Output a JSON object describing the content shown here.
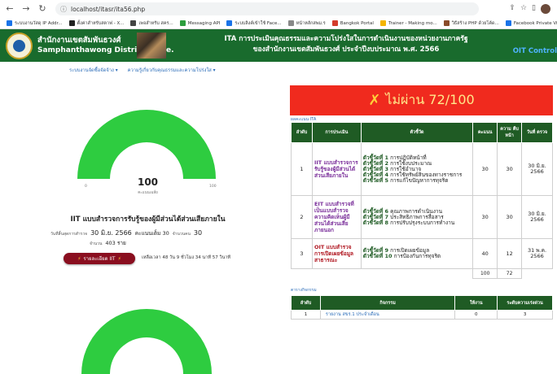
{
  "browser": {
    "url": "localhost/itasr/ita56.php",
    "bookmarks": [
      {
        "label": "ระบบงานวัสดุ IP Addr...",
        "color": "#1a73e8"
      },
      {
        "label": "ตั้งค่าสำหรับสตาฟ - X...",
        "color": "#222222"
      },
      {
        "label": "เพจสำหรับ สคร...",
        "color": "#444444"
      },
      {
        "label": "Messaging API",
        "color": "#2e9e3e"
      },
      {
        "label": "ระบบลิงค์เข้าใช้ Face...",
        "color": "#1a73e8"
      },
      {
        "label": "หน้าหลักสพม.ร",
        "color": "#888888"
      },
      {
        "label": "Bangkok Portal",
        "color": "#d33b2c"
      },
      {
        "label": "Trainer - Making mo...",
        "color": "#f4b400"
      },
      {
        "label": "วิธีสร้าง PHP ด้วยโค้ด...",
        "color": "#8a4b2a"
      },
      {
        "label": "Facebook Private Vi...",
        "color": "#1a73e8"
      }
    ]
  },
  "header": {
    "office_th": "สำนักงานเขตสัมพันธวงศ์",
    "office_en": "Samphanthawong District Office.",
    "ita_line1": "ITA การประเมินคุณธรรมและความโปร่งใสในการดำเนินงานของหน่วยงานภาครัฐ",
    "ita_line2": "ของสำนักงานเขตสัมพันธวงศ์ ประจำปีงบประมาณ พ.ศ. 2566",
    "oit_control": "OIT Control"
  },
  "subnav": {
    "item1": "ระบบงานจัดซื้อจัดจ้าง ▾",
    "item2": "ความรู้เกี่ยวกับคุณธรรมและความโปร่งใส ▾"
  },
  "gauge": {
    "value": "100",
    "min_label": "0",
    "max_label": "100",
    "caption": "คะแนนเฉลี่ย",
    "value_fraction": 1.0,
    "fill_color": "#2ecc40",
    "track_color": "#e6e6e6"
  },
  "indicator": {
    "title": "IIT แบบสำรวจการรับรู้ของผู้มีส่วนได้ส่วนเสียภายใน",
    "end_label": "วันที่สิ้นสุดการสำรวจ",
    "end_date": "30 มิ.ย. 2566",
    "full_label": "คะแนนเต็ม 30",
    "count_label": "จำนวนคน",
    "count_value": "30",
    "resp_label": "จำนวน",
    "resp_value": "403 ราย"
  },
  "result_button": "รายละเอียด IIT",
  "countdown": "เหลือเวลา 48 วัน 9 ชั่วโมง 34 นาที 57 วินาที",
  "fail_banner": {
    "text": "ไม่ผ่าน 72/100"
  },
  "score_section_label": "ผลคะแนน ITA",
  "score_table": {
    "headers": [
      "ลำดับ",
      "การประเมิน",
      "ตัวชี้วัด",
      "คะแนน",
      "ความ คืบ หน้า",
      "วันที่ ตรวจ"
    ],
    "rows": [
      {
        "no": "1",
        "tool": "IIT แบบสำรวจการรับรู้ของผู้มีส่วนได้ส่วนเสียภายใน",
        "indicators": [
          {
            "label": "ตัวชี้วัดที่ 1",
            "text": "การปฏิบัติหน้าที่"
          },
          {
            "label": "ตัวชี้วัดที่ 2",
            "text": "การใช้งบประมาณ"
          },
          {
            "label": "ตัวชี้วัดที่ 3",
            "text": "การใช้อำนาจ"
          },
          {
            "label": "ตัวชี้วัดที่ 4",
            "text": "การใช้ทรัพย์สินของทางราชการ"
          },
          {
            "label": "ตัวชี้วัดที่ 5",
            "text": "การแก้ไขปัญหาการทุจริต"
          }
        ],
        "score": "30",
        "progress": "30",
        "date": "30 มิ.ย. 2566"
      },
      {
        "no": "2",
        "tool": "EIT แบบสำรวจที่เป็นแบบสำรวจความคิดเห็นผู้มีส่วนได้ส่วนเสียภายนอก",
        "indicators": [
          {
            "label": "ตัวชี้วัดที่ 6",
            "text": "คุณภาพการดำเนินงาน"
          },
          {
            "label": "ตัวชี้วัดที่ 7",
            "text": "ประสิทธิภาพการสื่อสาร"
          },
          {
            "label": "ตัวชี้วัดที่ 8",
            "text": "การปรับปรุงระบบการทำงาน"
          }
        ],
        "score": "30",
        "progress": "30",
        "date": "30 มิ.ย. 2566"
      },
      {
        "no": "3",
        "tool": "OIT แบบสำรวจการเปิดเผยข้อมูลสาธารณะ",
        "indicators": [
          {
            "label": "ตัวชี้วัดที่ 9",
            "text": "การเปิดเผยข้อมูล"
          },
          {
            "label": "ตัวชี้วัดที่ 10",
            "text": "การป้องกันการทุจริต"
          }
        ],
        "score": "40",
        "progress": "12",
        "date": "31 พ.ค. 2566"
      }
    ],
    "total_score": "100",
    "total_progress": "72"
  },
  "activity_section_label": "ตารางกิจกรรม",
  "activity_table": {
    "headers": [
      "ลำดับ",
      "กิจกรรม",
      "ให้งาน",
      "ระดับความเร่งด่วน"
    ],
    "rows": [
      {
        "no": "1",
        "activity": "รายงาน สขร.1 ประจำเดือน",
        "assign": "0",
        "urgency": "3"
      }
    ]
  },
  "colors": {
    "header_green": "#196b2d",
    "table_header_green": "#1f5b24",
    "fail_red": "#f02a1e",
    "button_maroon": "#8a0e1f"
  }
}
